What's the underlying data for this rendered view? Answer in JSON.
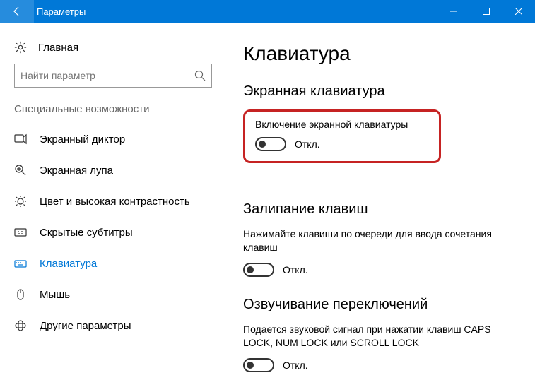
{
  "window": {
    "title": "Параметры"
  },
  "sidebar": {
    "home_label": "Главная",
    "search_placeholder": "Найти параметр",
    "group_header": "Специальные возможности",
    "items": [
      {
        "label": "Экранный диктор"
      },
      {
        "label": "Экранная лупа"
      },
      {
        "label": "Цвет и высокая контрастность"
      },
      {
        "label": "Скрытые субтитры"
      },
      {
        "label": "Клавиатура"
      },
      {
        "label": "Мышь"
      },
      {
        "label": "Другие параметры"
      }
    ]
  },
  "main": {
    "page_title": "Клавиатура",
    "sections": [
      {
        "heading": "Экранная клавиатура",
        "setting_label": "Включение экранной клавиатуры",
        "toggle_state": "Откл."
      },
      {
        "heading": "Залипание клавиш",
        "setting_desc": "Нажимайте клавиши по очереди для ввода сочетания клавиш",
        "toggle_state": "Откл."
      },
      {
        "heading": "Озвучивание переключений",
        "setting_desc": "Подается звуковой сигнал при нажатии клавиш CAPS LOCK, NUM LOCK или SCROLL LOCK",
        "toggle_state": "Откл."
      }
    ]
  }
}
